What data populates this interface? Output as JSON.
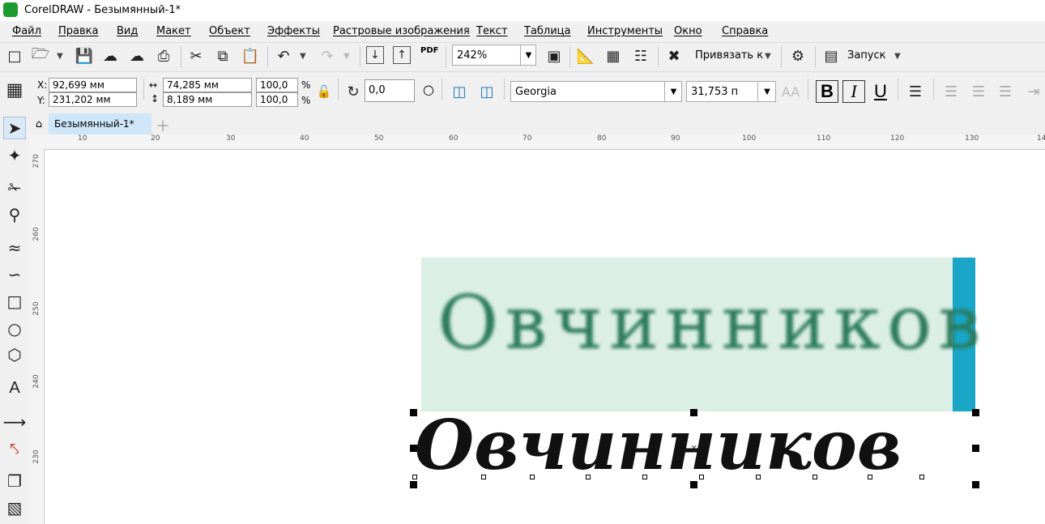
{
  "window": {
    "title": "CorelDRAW - Безымянный-1*"
  },
  "menu": [
    "Файл",
    "Правка",
    "Вид",
    "Макет",
    "Объект",
    "Эффекты",
    "Растровые изображения",
    "Текст",
    "Таблица",
    "Инструменты",
    "Окно",
    "Справка"
  ],
  "toolbar": {
    "zoom": "242%",
    "snap_label": "Привязать к",
    "launch_label": "Запуск",
    "pdf_label": "PDF"
  },
  "property_bar": {
    "x_label": "X:",
    "x_value": "92,699 мм",
    "y_label": "Y:",
    "y_value": "231,202 мм",
    "width_value": "74,285 мм",
    "height_value": "8,189 мм",
    "scale_x": "100,0",
    "scale_y": "100,0",
    "percent": "%",
    "rotation": "0,0",
    "font_name": "Georgia",
    "font_size": "31,753 п",
    "bold": "B",
    "italic": "I",
    "underline": "U"
  },
  "tabs": {
    "document": "Безымянный-1*"
  },
  "rulers": {
    "horizontal": [
      "10",
      "20",
      "30",
      "40",
      "50",
      "60",
      "70",
      "80",
      "90",
      "100",
      "110",
      "120",
      "130",
      "14"
    ],
    "vertical": [
      "270",
      "260",
      "250",
      "240",
      "230"
    ]
  },
  "canvas": {
    "bitmap_text": "Овчинников",
    "text_object": "Овчинников"
  },
  "colors": {
    "accent": "#4aa3df",
    "tab_active": "#cfe6f8",
    "bitmap_bg": "#dcefe6",
    "bitmap_ink": "#2b7a5d"
  }
}
